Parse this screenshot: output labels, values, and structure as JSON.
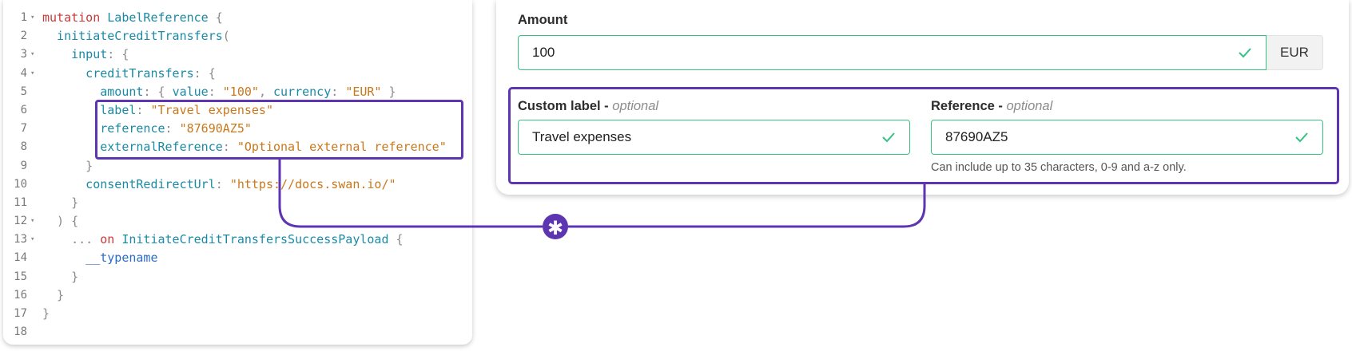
{
  "code": {
    "lines": [
      {
        "n": "1",
        "fold": true,
        "tokens": [
          {
            "t": "mutation ",
            "c": "c-kw"
          },
          {
            "t": "LabelReference",
            "c": "c-type"
          },
          {
            "t": " {",
            "c": "c-punct"
          }
        ]
      },
      {
        "n": "2",
        "fold": false,
        "tokens": [
          {
            "t": "  initiateCreditTransfers",
            "c": "c-fn"
          },
          {
            "t": "(",
            "c": "c-punct"
          }
        ]
      },
      {
        "n": "3",
        "fold": true,
        "tokens": [
          {
            "t": "    input",
            "c": "c-prop"
          },
          {
            "t": ": {",
            "c": "c-punct"
          }
        ]
      },
      {
        "n": "4",
        "fold": true,
        "tokens": [
          {
            "t": "      creditTransfers",
            "c": "c-prop"
          },
          {
            "t": ": {",
            "c": "c-punct"
          }
        ]
      },
      {
        "n": "5",
        "fold": false,
        "tokens": [
          {
            "t": "        amount",
            "c": "c-prop"
          },
          {
            "t": ": { ",
            "c": "c-punct"
          },
          {
            "t": "value",
            "c": "c-prop"
          },
          {
            "t": ": ",
            "c": "c-punct"
          },
          {
            "t": "\"100\"",
            "c": "c-str"
          },
          {
            "t": ", ",
            "c": "c-punct"
          },
          {
            "t": "currency",
            "c": "c-prop"
          },
          {
            "t": ": ",
            "c": "c-punct"
          },
          {
            "t": "\"EUR\"",
            "c": "c-str"
          },
          {
            "t": " }",
            "c": "c-punct"
          }
        ]
      },
      {
        "n": "6",
        "fold": false,
        "tokens": [
          {
            "t": "        label",
            "c": "c-prop"
          },
          {
            "t": ": ",
            "c": "c-punct"
          },
          {
            "t": "\"Travel expenses\"",
            "c": "c-str"
          }
        ]
      },
      {
        "n": "7",
        "fold": false,
        "tokens": [
          {
            "t": "        reference",
            "c": "c-prop"
          },
          {
            "t": ": ",
            "c": "c-punct"
          },
          {
            "t": "\"87690AZ5\"",
            "c": "c-str"
          }
        ]
      },
      {
        "n": "8",
        "fold": false,
        "tokens": [
          {
            "t": "        externalReference",
            "c": "c-prop"
          },
          {
            "t": ": ",
            "c": "c-punct"
          },
          {
            "t": "\"Optional external reference\"",
            "c": "c-str"
          }
        ]
      },
      {
        "n": "9",
        "fold": false,
        "tokens": [
          {
            "t": "      }",
            "c": "c-punct"
          }
        ]
      },
      {
        "n": "10",
        "fold": false,
        "tokens": [
          {
            "t": "      consentRedirectUrl",
            "c": "c-prop"
          },
          {
            "t": ": ",
            "c": "c-punct"
          },
          {
            "t": "\"https://docs.swan.io/\"",
            "c": "c-str"
          }
        ]
      },
      {
        "n": "11",
        "fold": false,
        "tokens": [
          {
            "t": "    }",
            "c": "c-punct"
          }
        ]
      },
      {
        "n": "12",
        "fold": true,
        "tokens": [
          {
            "t": "  ) {",
            "c": "c-punct"
          }
        ]
      },
      {
        "n": "13",
        "fold": true,
        "tokens": [
          {
            "t": "    ... ",
            "c": "c-punct"
          },
          {
            "t": "on ",
            "c": "c-kw"
          },
          {
            "t": "InitiateCreditTransfersSuccessPayload",
            "c": "c-type"
          },
          {
            "t": " {",
            "c": "c-punct"
          }
        ]
      },
      {
        "n": "14",
        "fold": false,
        "tokens": [
          {
            "t": "      __typename",
            "c": "c-tn"
          }
        ]
      },
      {
        "n": "15",
        "fold": false,
        "tokens": [
          {
            "t": "    }",
            "c": "c-punct"
          }
        ]
      },
      {
        "n": "16",
        "fold": false,
        "tokens": [
          {
            "t": "  }",
            "c": "c-punct"
          }
        ]
      },
      {
        "n": "17",
        "fold": false,
        "tokens": [
          {
            "t": "}",
            "c": "c-punct"
          }
        ]
      },
      {
        "n": "18",
        "fold": false,
        "tokens": []
      }
    ]
  },
  "form": {
    "amount": {
      "label": "Amount",
      "value": "100",
      "currency": "EUR"
    },
    "custom_label": {
      "label": "Custom label - ",
      "optional": "optional",
      "value": "Travel expenses"
    },
    "reference": {
      "label": "Reference - ",
      "optional": "optional",
      "value": "87690AZ5",
      "hint": "Can include up to 35 characters, 0-9 and a-z only."
    }
  },
  "connector": {
    "symbol": "✱"
  },
  "colors": {
    "accent": "#5d35b1",
    "valid": "#34c381"
  }
}
